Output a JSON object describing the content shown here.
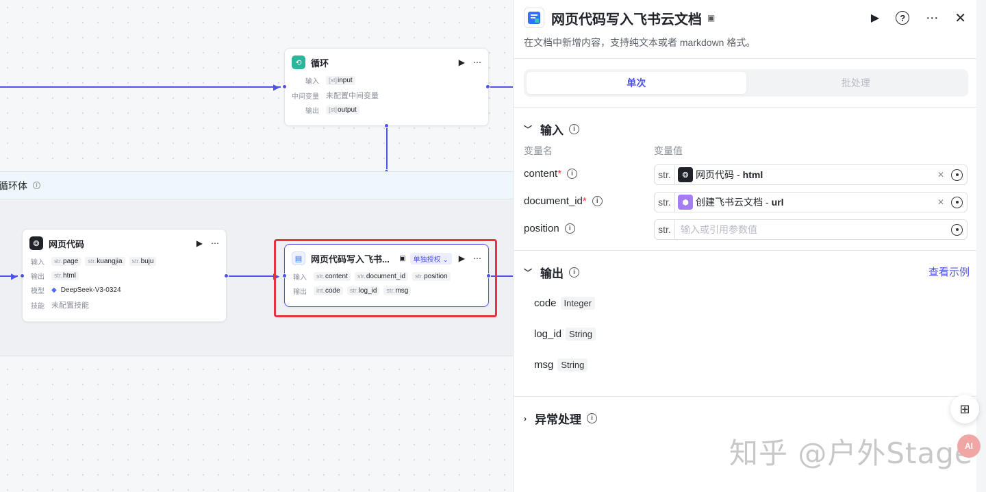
{
  "canvas": {
    "loop_node": {
      "title": "循环",
      "input_label": "输入",
      "input_var": "input",
      "input_type": "[st]",
      "mid_label": "中间变量",
      "mid_value": "未配置中间变量",
      "output_label": "输出",
      "output_var": "output",
      "output_type": "[st]"
    },
    "loop_body_label": "循环体",
    "web_code_node": {
      "title": "网页代码",
      "input_label": "输入",
      "inputs": [
        {
          "type": "str.",
          "name": "page"
        },
        {
          "type": "str.",
          "name": "kuangjia"
        },
        {
          "type": "str.",
          "name": "buju"
        }
      ],
      "output_label": "输出",
      "outputs": [
        {
          "type": "str.",
          "name": "html"
        }
      ],
      "model_label": "模型",
      "model_value": "DeepSeek-V3-0324",
      "skill_label": "技能",
      "skill_value": "未配置技能"
    },
    "doc_node": {
      "title": "网页代码写入飞书...",
      "badge": "单独授权",
      "input_label": "输入",
      "inputs": [
        {
          "type": "str.",
          "name": "content"
        },
        {
          "type": "str.",
          "name": "document_id"
        },
        {
          "type": "str.",
          "name": "position"
        }
      ],
      "output_label": "输出",
      "outputs": [
        {
          "type": "int.",
          "name": "code"
        },
        {
          "type": "str.",
          "name": "log_id"
        },
        {
          "type": "str.",
          "name": "msg"
        }
      ]
    },
    "accent_color": "#4d53e8",
    "highlight_color": "#e8323c"
  },
  "panel": {
    "title": "网页代码写入飞书云文档",
    "description": "在文档中新增内容，支持纯文本或者 markdown 格式。",
    "tabs": [
      {
        "label": "单次",
        "active": true
      },
      {
        "label": "批处理",
        "active": false
      }
    ],
    "input_section": {
      "title": "输入",
      "col_name": "变量名",
      "col_value": "变量值",
      "params": [
        {
          "name": "content",
          "required": "*",
          "type": "str.",
          "ref_node": "网页代码",
          "ref_var": "html",
          "placeholder": ""
        },
        {
          "name": "document_id",
          "required": "*",
          "type": "str.",
          "ref_node": "创建飞书云文档",
          "ref_var": "url",
          "placeholder": ""
        },
        {
          "name": "position",
          "required": "",
          "type": "str.",
          "ref_node": "",
          "ref_var": "",
          "placeholder": "输入或引用参数值"
        }
      ]
    },
    "output_section": {
      "title": "输出",
      "example_link": "查看示例",
      "outputs": [
        {
          "name": "code",
          "type": "Integer"
        },
        {
          "name": "log_id",
          "type": "String"
        },
        {
          "name": "msg",
          "type": "String"
        }
      ]
    },
    "exception_section": {
      "title": "异常处理"
    },
    "ref_separator": "-"
  },
  "watermark": "知乎 @户外Stage",
  "icons": [
    "loop-icon",
    "play-icon",
    "more-icon",
    "help-icon",
    "close-icon",
    "info-icon",
    "chevron-down-icon",
    "chevron-right-icon",
    "target-icon",
    "clear-icon",
    "edit-icon",
    "apps-icon",
    "deepseek-icon"
  ]
}
